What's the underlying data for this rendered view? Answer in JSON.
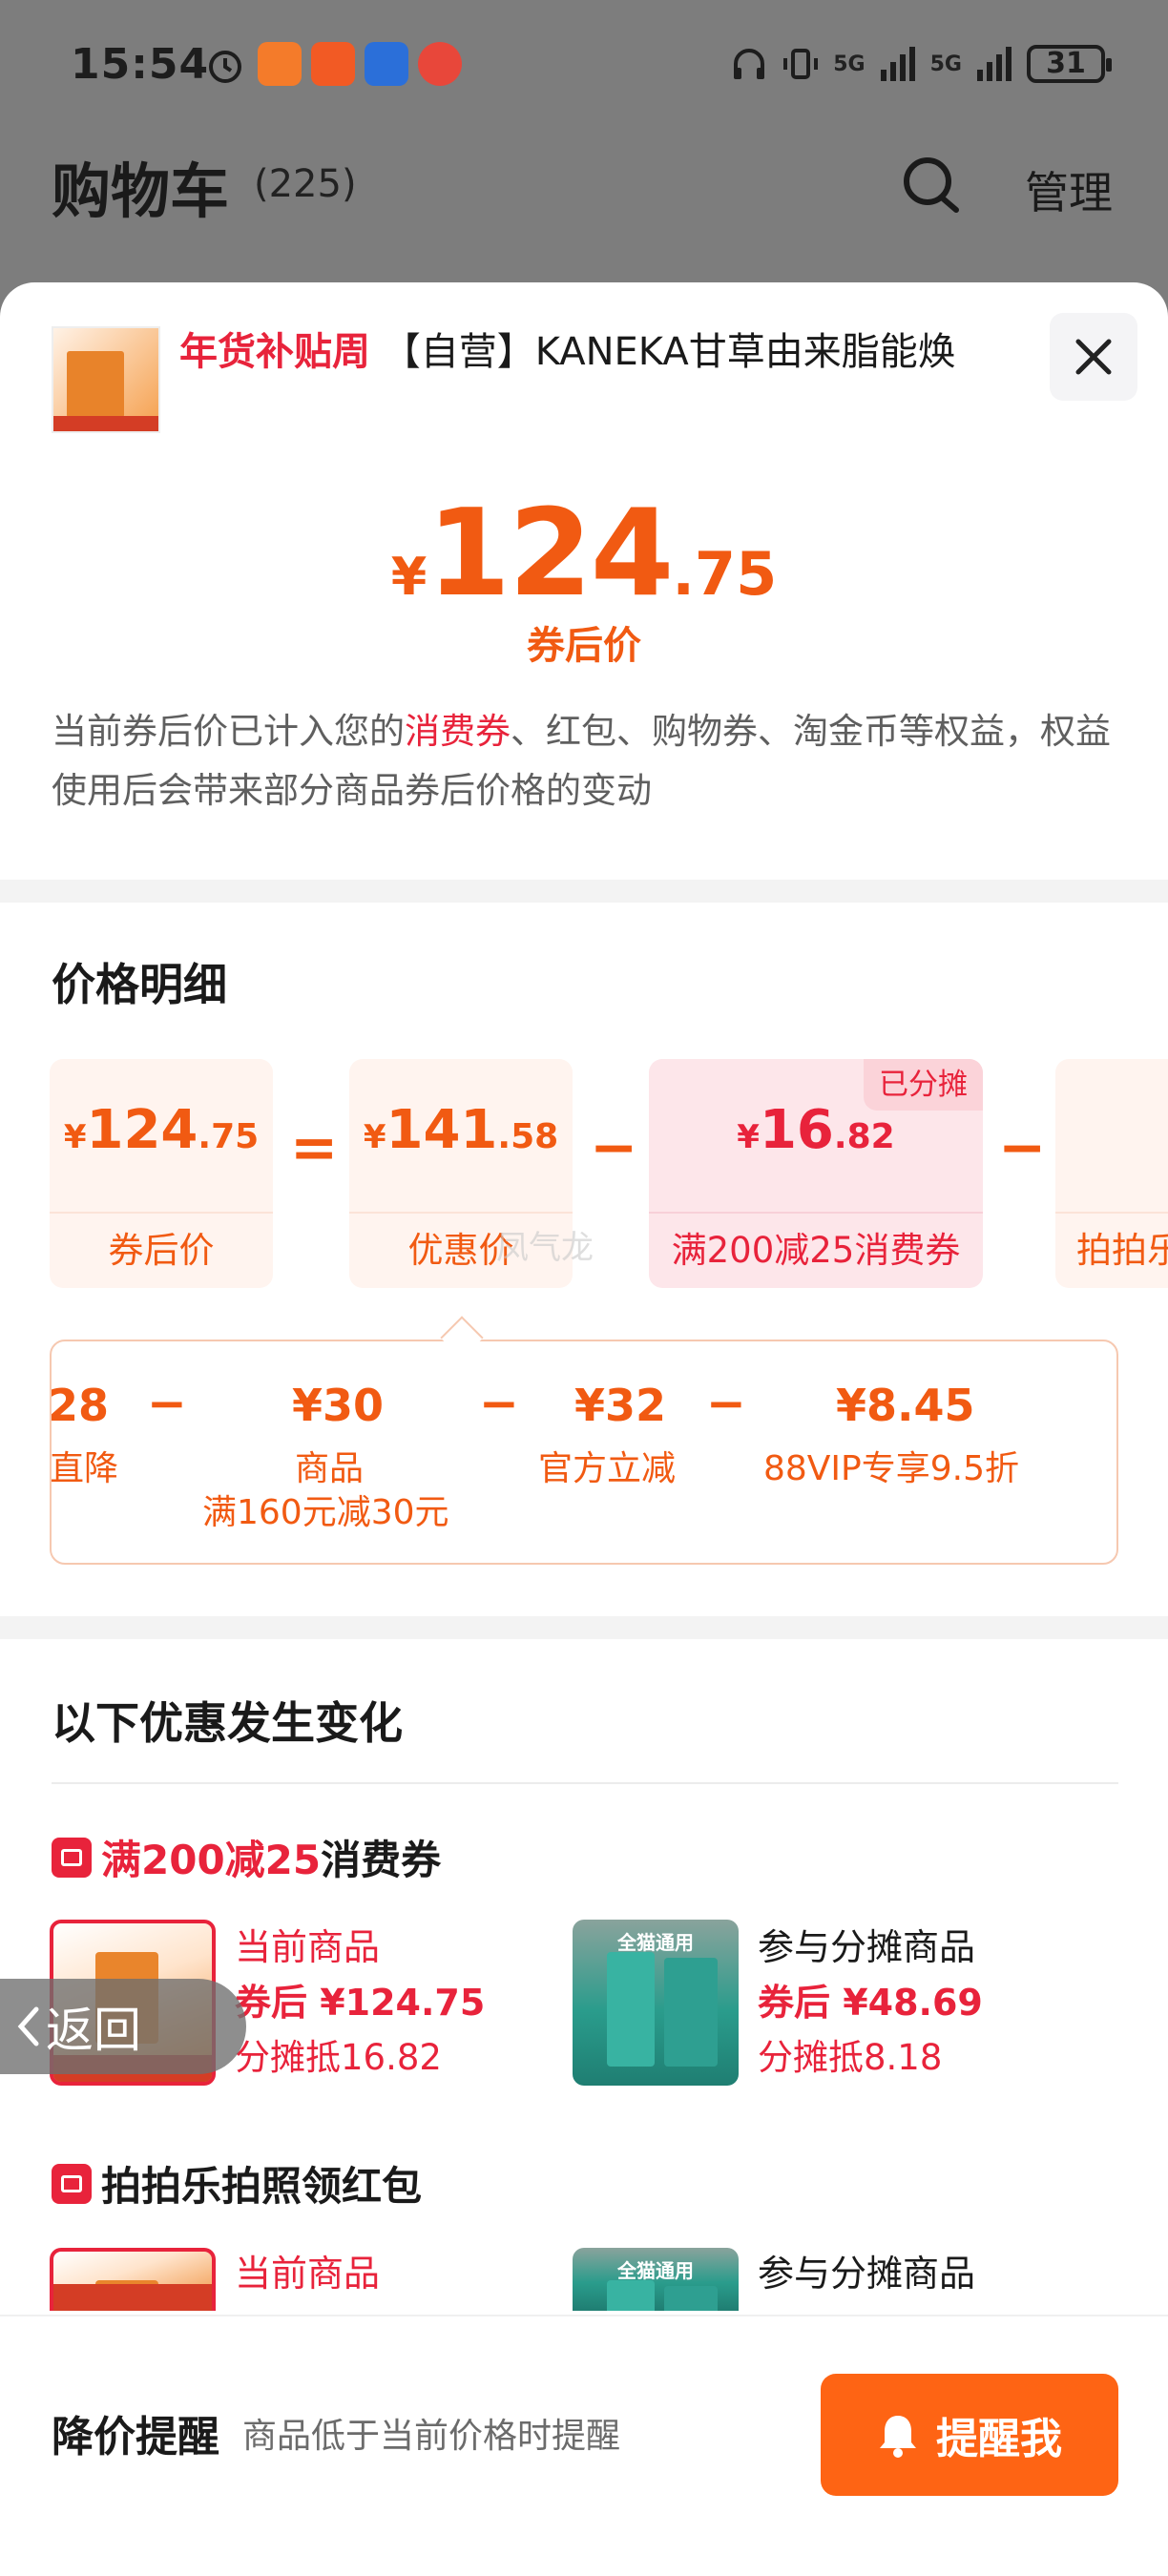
{
  "status_bar": {
    "time": "15:54",
    "signal_1": "5G",
    "signal_2": "5G",
    "battery": "31"
  },
  "cart": {
    "title": "购物车",
    "count": "(225)",
    "manage": "管理"
  },
  "product": {
    "tag": "年货补贴周",
    "title": "【自营】KANEKA甘草由来脂能焕"
  },
  "price": {
    "currency": "¥",
    "integer": "124",
    "decimal": ".75",
    "caption": "券后价"
  },
  "notice": {
    "part1": "当前券后价已计入您的",
    "highlight": "消费券",
    "part2": "、红包、购物券、淘金币等权益，权益使用后会带来部分商品券后价格的变动"
  },
  "detail": {
    "title": "价格明细",
    "cards": [
      {
        "currency": "¥",
        "integer": "124",
        "decimal": ".75",
        "label": "券后价"
      },
      {
        "currency": "¥",
        "integer": "141",
        "decimal": ".58",
        "label": "优惠价"
      },
      {
        "currency": "¥",
        "integer": "16",
        "decimal": ".82",
        "label": "满200减25消费券",
        "badge": "已分摊"
      },
      {
        "currency": "",
        "integer": "",
        "decimal": "",
        "label": "拍拍乐"
      }
    ],
    "ops": [
      "=",
      "−",
      "−"
    ]
  },
  "breakdown": {
    "items": [
      {
        "value": "28",
        "label": "直降"
      },
      {
        "value": "¥30",
        "label": "商品\n满160元减30元"
      },
      {
        "value": "¥32",
        "label": "官方立减"
      },
      {
        "value": "¥8.45",
        "label": "88VIP专享9.5折"
      }
    ],
    "op": "−"
  },
  "changes": {
    "title": "以下优惠发生变化",
    "groups": [
      {
        "name_red": "满200减25",
        "name_rest": "消费券",
        "current": {
          "l1": "当前商品",
          "l2": "券后 ¥124.75",
          "l3": "分摊抵16.82"
        },
        "shared": {
          "l1": "参与分摊商品",
          "l2": "券后 ¥48.69",
          "l3": "分摊抵8.18",
          "img_caption": "全猫通用"
        }
      },
      {
        "name_red": "",
        "name_rest": "拍拍乐拍照领红包",
        "current": {
          "l1": "当前商品"
        },
        "shared": {
          "l1": "参与分摊商品",
          "img_caption": "全猫通用"
        }
      }
    ]
  },
  "back_button": "返回",
  "watermark": "凤气龙",
  "footer": {
    "title": "降价提醒",
    "desc": "商品低于当前价格时提醒",
    "button": "提醒我"
  },
  "colors": {
    "accent_orange": "#f15a12",
    "accent_red": "#e8233b",
    "button_orange": "#fe6414"
  }
}
